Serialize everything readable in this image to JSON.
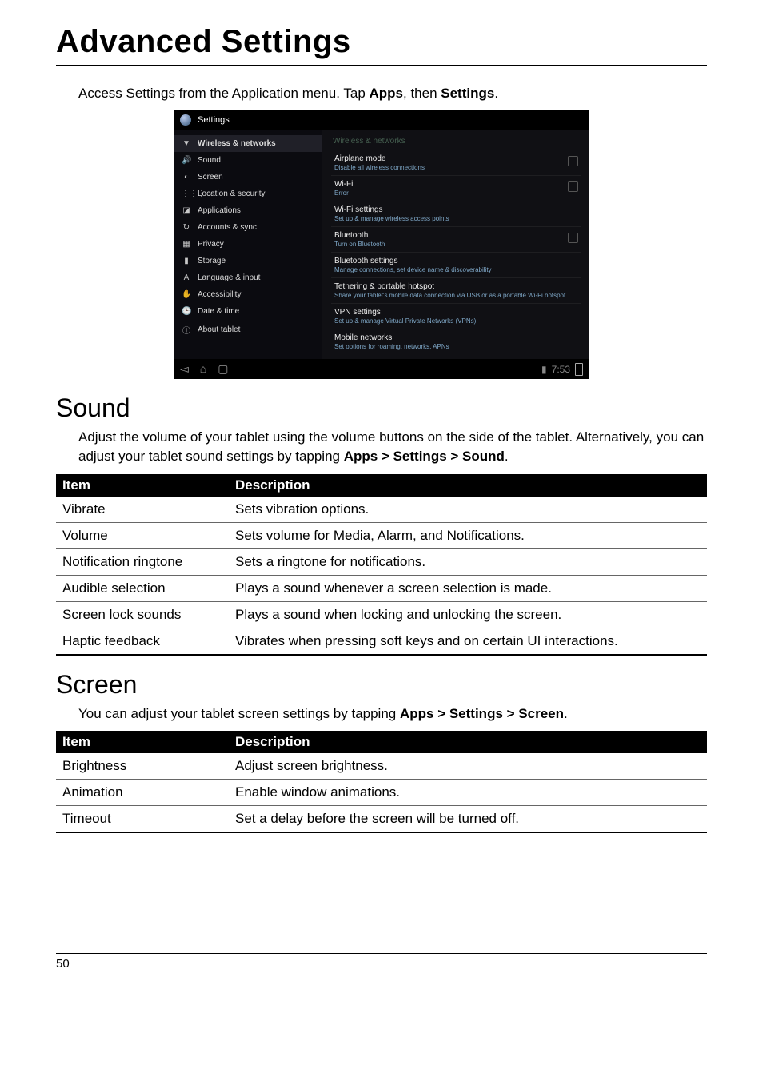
{
  "page": {
    "title": "Advanced Settings",
    "page_number": "50"
  },
  "intro": {
    "prefix": "Access Settings from the Application menu. Tap ",
    "apps": "Apps",
    "mid": ", then ",
    "settings": "Settings",
    "suffix": "."
  },
  "screenshot": {
    "header": "Settings",
    "sidebar": [
      {
        "icon": "▼",
        "label": "Wireless & networks",
        "selected": true
      },
      {
        "icon": "🔊",
        "label": "Sound"
      },
      {
        "icon": "◐",
        "label": "Screen"
      },
      {
        "icon": "⋮⋮⋮",
        "label": "Location & security"
      },
      {
        "icon": "◪",
        "label": "Applications"
      },
      {
        "icon": "↻",
        "label": "Accounts & sync"
      },
      {
        "icon": "▦",
        "label": "Privacy"
      },
      {
        "icon": "▮",
        "label": "Storage"
      },
      {
        "icon": "A",
        "label": "Language & input"
      },
      {
        "icon": "✋",
        "label": "Accessibility"
      },
      {
        "icon": "🕒",
        "label": "Date & time"
      },
      {
        "icon": "ⓘ",
        "label": "About tablet"
      }
    ],
    "detail_header": "Wireless & networks",
    "rows": [
      {
        "title": "Airplane mode",
        "sub": "Disable all wireless connections",
        "checkbox": true
      },
      {
        "title": "Wi-Fi",
        "sub": "Error",
        "checkbox": true
      },
      {
        "title": "Wi-Fi settings",
        "sub": "Set up & manage wireless access points",
        "checkbox": false
      },
      {
        "title": "Bluetooth",
        "sub": "Turn on Bluetooth",
        "checkbox": true
      },
      {
        "title": "Bluetooth settings",
        "sub": "Manage connections, set device name & discoverability",
        "checkbox": false
      },
      {
        "title": "Tethering & portable hotspot",
        "sub": "Share your tablet's mobile data connection via USB or as a portable Wi-Fi hotspot",
        "checkbox": false
      },
      {
        "title": "VPN settings",
        "sub": "Set up & manage Virtual Private Networks (VPNs)",
        "checkbox": false
      },
      {
        "title": "Mobile networks",
        "sub": "Set options for roaming, networks, APNs",
        "checkbox": false
      }
    ],
    "nav": {
      "back": "◅",
      "home": "⌂",
      "recent": "▢",
      "signal": "▮",
      "time": "7:53"
    }
  },
  "sound": {
    "heading": "Sound",
    "body_prefix": "Adjust the volume of your tablet using the volume buttons on the side of the tablet. Alternatively, you can adjust your tablet sound settings by tapping ",
    "path1": "Apps",
    "sep1": " > ",
    "path2": "Settings",
    "sep2": " > ",
    "path3": "Sound",
    "suffix": ".",
    "table": {
      "headers": {
        "item": "Item",
        "desc": "Description"
      },
      "rows": [
        {
          "item": "Vibrate",
          "desc": "Sets vibration options."
        },
        {
          "item": "Volume",
          "desc": "Sets volume for Media, Alarm, and Notifications."
        },
        {
          "item": "Notification ringtone",
          "desc": "Sets a ringtone for notifications."
        },
        {
          "item": "Audible selection",
          "desc": "Plays a sound whenever a screen selection is made."
        },
        {
          "item": "Screen lock sounds",
          "desc": "Plays a sound when locking and unlocking the screen."
        },
        {
          "item": "Haptic feedback",
          "desc": "Vibrates when pressing soft keys and on certain UI interactions."
        }
      ]
    }
  },
  "screen": {
    "heading": "Screen",
    "body_prefix": "You can adjust your tablet screen settings by tapping ",
    "path1": "Apps",
    "sep1": " > ",
    "path2": "Settings",
    "sep2": " > ",
    "path3": "Screen",
    "suffix": ".",
    "table": {
      "headers": {
        "item": "Item",
        "desc": "Description"
      },
      "rows": [
        {
          "item": "Brightness",
          "desc": "Adjust screen brightness."
        },
        {
          "item": "Animation",
          "desc": "Enable window animations."
        },
        {
          "item": "Timeout",
          "desc": "Set a delay before the screen will be turned off."
        }
      ]
    }
  }
}
